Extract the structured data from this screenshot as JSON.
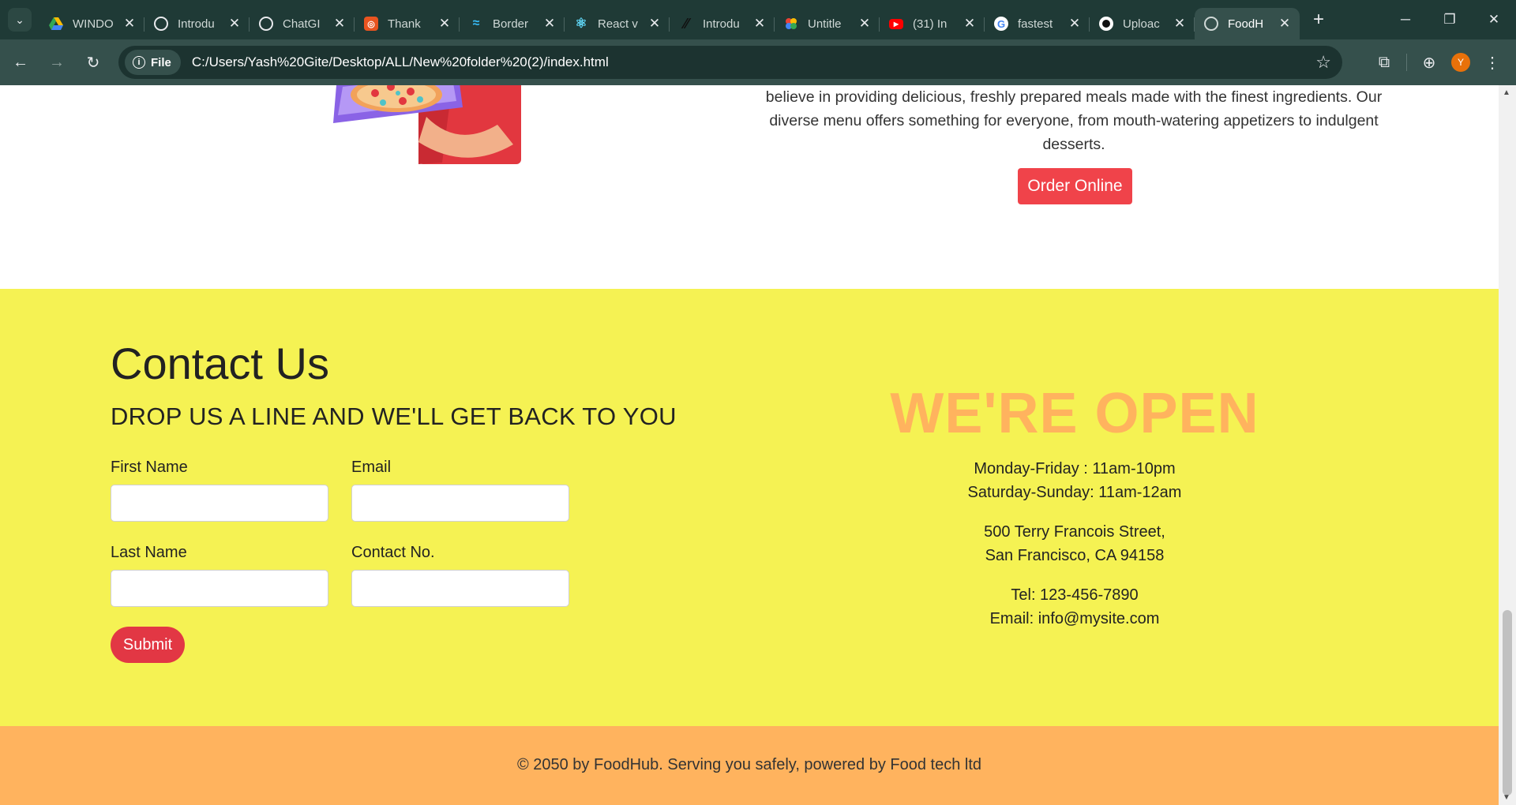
{
  "browser": {
    "tabs": [
      {
        "title": "WINDO",
        "favicon": "google-drive-icon",
        "active": false
      },
      {
        "title": "Introdu",
        "favicon": "openai-icon",
        "active": false
      },
      {
        "title": "ChatGI",
        "favicon": "openai-icon",
        "active": false
      },
      {
        "title": "Thank",
        "favicon": "ubuntu-icon",
        "active": false
      },
      {
        "title": "Border",
        "favicon": "tailwind-icon",
        "active": false
      },
      {
        "title": "React v",
        "favicon": "react-icon",
        "active": false
      },
      {
        "title": "Introdu",
        "favicon": "slash-icon",
        "active": false
      },
      {
        "title": "Untitle",
        "favicon": "google-photos-icon",
        "active": false
      },
      {
        "title": "(31) In",
        "favicon": "youtube-icon",
        "active": false
      },
      {
        "title": "fastest",
        "favicon": "google-icon",
        "active": false
      },
      {
        "title": "Uploac",
        "favicon": "github-icon",
        "active": false
      },
      {
        "title": "FoodH",
        "favicon": "globe-icon",
        "active": true
      }
    ],
    "address": {
      "chip_label": "File",
      "url": "C:/Users/Yash%20Gite/Desktop/ALL/New%20folder%20(2)/index.html"
    },
    "profile_initial": "Y"
  },
  "about": {
    "text": "believe in providing delicious, freshly prepared meals made with the finest ingredients. Our diverse menu offers something for everyone, from mouth-watering appetizers to indulgent desserts.",
    "order_button": "Order Online"
  },
  "contact": {
    "title": "Contact Us",
    "subtitle": "DROP US A LINE AND WE'LL GET BACK TO YOU",
    "fields": {
      "first_name": "First Name",
      "email": "Email",
      "last_name": "Last Name",
      "contact_no": "Contact No."
    },
    "submit": "Submit"
  },
  "hours": {
    "title": "WE'RE OPEN",
    "weekday": "Monday-Friday : 11am-10pm",
    "weekend": "Saturday-Sunday: 11am-12am",
    "address_line1": "500 Terry Francois Street,",
    "address_line2": "San Francisco, CA 94158",
    "tel": "Tel: 123-456-7890",
    "email": "Email: info@mysite.com"
  },
  "footer": {
    "text": "© 2050 by FoodHub. Serving you safely, powered by Food tech ltd"
  },
  "colors": {
    "contact_bg": "#f5f253",
    "accent_orange": "#ffb35e",
    "order_button": "#f0434a",
    "submit_button": "#e23744"
  }
}
